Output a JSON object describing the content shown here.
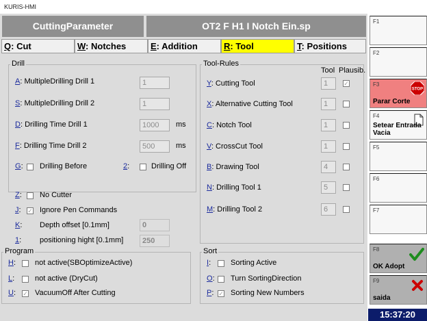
{
  "window_title": "KURIS-HMI",
  "header": {
    "left": "CuttingParameter",
    "right": "OT2 F H1 I Notch Ein.sp"
  },
  "tabs": [
    {
      "key": "Q",
      "label": ": Cut"
    },
    {
      "key": "W",
      "label": ": Notches"
    },
    {
      "key": "E",
      "label": ": Addition"
    },
    {
      "key": "R",
      "label": ": Tool"
    },
    {
      "key": "T",
      "label": ": Positions"
    }
  ],
  "drill": {
    "title": "Drill",
    "rows": [
      {
        "key": "A",
        "label": ": MultipleDrilling Drill 1",
        "value": "1",
        "unit": ""
      },
      {
        "key": "S",
        "label": ": MultipleDrilling Drill 2",
        "value": "1",
        "unit": ""
      },
      {
        "key": "D",
        "label": ": Drilling Time Drill 1",
        "value": "1000",
        "unit": "ms"
      },
      {
        "key": "F",
        "label": ": Drilling Time Drill 2",
        "value": "500",
        "unit": "ms"
      }
    ],
    "before_key": "G",
    "before_label": "Drilling Before",
    "off_key": "2",
    "off_label": "Drilling Off"
  },
  "misc": {
    "rows": [
      {
        "key": "Z",
        "label": "No Cutter",
        "checked": ""
      },
      {
        "key": "J",
        "label": "Ignore Pen Commands",
        "checked": "✓"
      }
    ],
    "depth_key": "K",
    "depth_label": "Depth offset [0.1mm]",
    "depth_value": "0",
    "pos_key": "1",
    "pos_label": "positioning hight [0.1mm]",
    "pos_value": "250"
  },
  "program": {
    "title": "Program",
    "rows": [
      {
        "key": "H",
        "label": "not active(SBOptimizeActive)",
        "checked": ""
      },
      {
        "key": "L",
        "label": "not active (DryCut)",
        "checked": ""
      },
      {
        "key": "U",
        "label": "VacuumOff After Cutting",
        "checked": "✓"
      }
    ]
  },
  "tool_rules": {
    "title": "Tool-Rules",
    "col_tool": "Tool",
    "col_plausib": "Plausib.",
    "rows": [
      {
        "key": "Y",
        "label": ": Cutting Tool",
        "tool": "1",
        "plaus": "✓"
      },
      {
        "key": "X",
        "label": ": Alternative Cutting Tool",
        "tool": "1",
        "plaus": ""
      },
      {
        "key": "C",
        "label": ": Notch Tool",
        "tool": "1",
        "plaus": ""
      },
      {
        "key": "V",
        "label": ": CrossCut Tool",
        "tool": "1",
        "plaus": ""
      },
      {
        "key": "B",
        "label": ": Drawing Tool",
        "tool": "4",
        "plaus": ""
      },
      {
        "key": "N",
        "label": ": Drilling Tool 1",
        "tool": "5",
        "plaus": ""
      },
      {
        "key": "M",
        "label": ": Drilling Tool 2",
        "tool": "6",
        "plaus": ""
      }
    ]
  },
  "sort": {
    "title": "Sort",
    "rows": [
      {
        "key": "I",
        "label": "Sorting Active",
        "checked": ""
      },
      {
        "key": "O",
        "label": "Turn SortingDirection",
        "checked": ""
      },
      {
        "key": "P",
        "label": "Sorting New Numbers",
        "checked": "✓"
      }
    ]
  },
  "fkeys": [
    {
      "key": "F1",
      "label": ""
    },
    {
      "key": "F2",
      "label": ""
    },
    {
      "key": "F3",
      "label": "Parar Corte",
      "icon": "stop-sign-icon",
      "icon_text": "STOP"
    },
    {
      "key": "F4",
      "label": "Setear Entrada\nVacia",
      "icon": "document-icon"
    },
    {
      "key": "F5",
      "label": ""
    },
    {
      "key": "F6",
      "label": ""
    },
    {
      "key": "F7",
      "label": ""
    },
    {
      "key": "F8",
      "label": "OK Adopt",
      "icon": "checkmark-icon"
    },
    {
      "key": "F9",
      "label": "saida",
      "icon": "cross-icon"
    }
  ],
  "clock": "15:37:20"
}
